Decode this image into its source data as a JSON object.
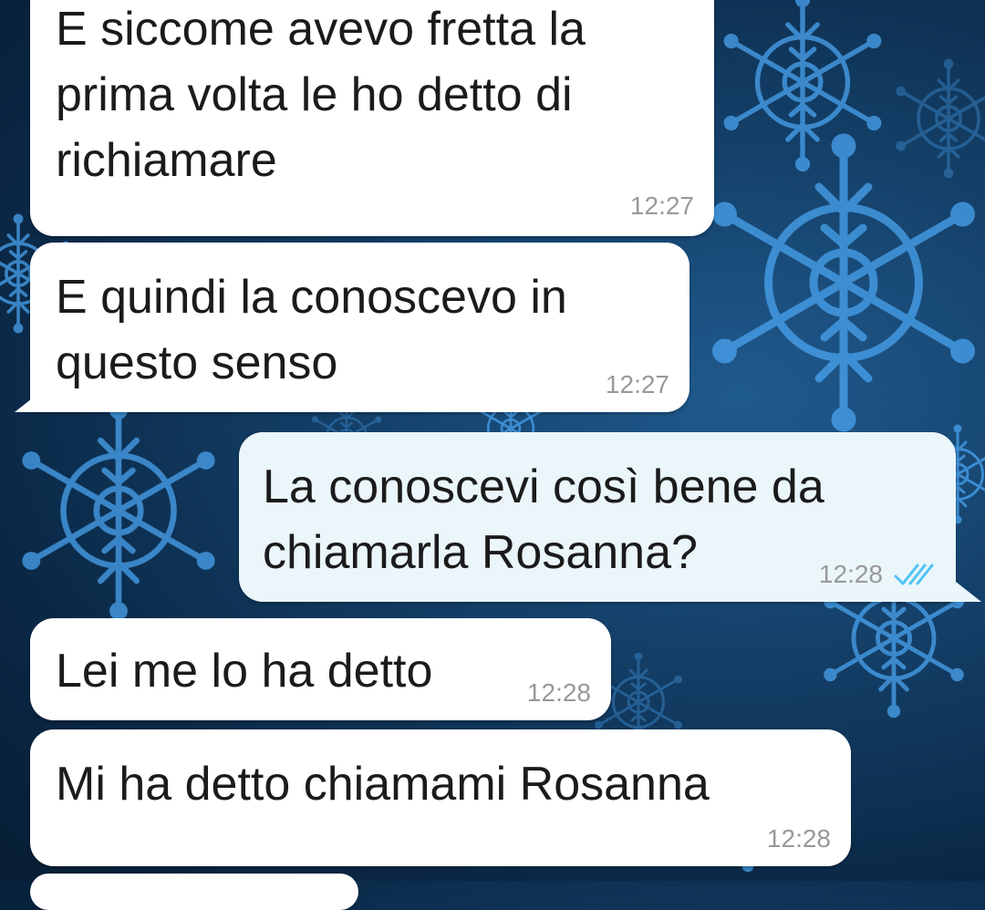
{
  "colors": {
    "incoming_bubble": "#ffffff",
    "outgoing_bubble": "#ebf6fa",
    "timestamp": "#999999",
    "read_ticks": "#4fc3f7",
    "wallpaper": "#0e3358",
    "snowflake": "#4aa3ef"
  },
  "messages": [
    {
      "direction": "incoming",
      "text": "E siccome avevo fretta la\nprima volta le ho detto di\nrichiamare",
      "time": "12:27"
    },
    {
      "direction": "incoming",
      "text": "E quindi la conoscevo in\nquesto senso",
      "time": "12:27"
    },
    {
      "direction": "outgoing",
      "text": "La conoscevi così bene da\nchiamarla Rosanna?",
      "time": "12:28",
      "status_icon": "double-check-icon"
    },
    {
      "direction": "incoming",
      "text": "Lei me lo ha detto",
      "time": "12:28"
    },
    {
      "direction": "incoming",
      "text": "Mi ha detto chiamami Rosanna",
      "time": "12:28"
    }
  ]
}
